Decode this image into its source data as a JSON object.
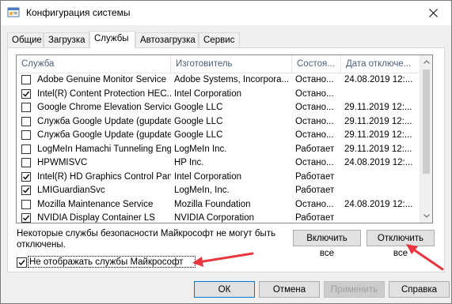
{
  "window": {
    "title": "Конфигурация системы"
  },
  "tabs": [
    {
      "label": "Общие"
    },
    {
      "label": "Загрузка"
    },
    {
      "label": "Службы"
    },
    {
      "label": "Автозагрузка"
    },
    {
      "label": "Сервис"
    }
  ],
  "columns": {
    "service": "Служба",
    "manufacturer": "Изготовитель",
    "status": "Состоя...",
    "date": "Дата отключе..."
  },
  "services": [
    {
      "name": "Adobe Genuine Monitor Service",
      "manufacturer": "Adobe Systems, Incorpora...",
      "status": "Остано...",
      "date": "24.08.2019 12:...",
      "checked": false
    },
    {
      "name": "Intel(R) Content Protection HEC...",
      "manufacturer": "Intel Corporation",
      "status": "Остано...",
      "date": "",
      "checked": true
    },
    {
      "name": "Google Chrome Elevation Service",
      "manufacturer": "Google LLC",
      "status": "Остано...",
      "date": "29.11.2019 12:...",
      "checked": false
    },
    {
      "name": "Служба Google Update (gupdate)",
      "manufacturer": "Google LLC",
      "status": "Остано...",
      "date": "29.11.2019 12:...",
      "checked": false
    },
    {
      "name": "Служба Google Update (gupdatem)",
      "manufacturer": "Google LLC",
      "status": "Остано...",
      "date": "29.11.2019 12:...",
      "checked": false
    },
    {
      "name": "LogMeIn Hamachi Tunneling Engine",
      "manufacturer": "LogMeIn Inc.",
      "status": "Работает",
      "date": "29.11.2019 12:...",
      "checked": false
    },
    {
      "name": "HPWMISVC",
      "manufacturer": "HP Inc.",
      "status": "Остано...",
      "date": "24.08.2019 12:...",
      "checked": false
    },
    {
      "name": "Intel(R) HD Graphics Control Pan...",
      "manufacturer": "Intel Corporation",
      "status": "Работает",
      "date": "",
      "checked": true
    },
    {
      "name": "LMIGuardianSvc",
      "manufacturer": "LogMeIn, Inc.",
      "status": "Работает",
      "date": "",
      "checked": true
    },
    {
      "name": "Mozilla Maintenance Service",
      "manufacturer": "Mozilla Foundation",
      "status": "Остано...",
      "date": "24.08.2019 12:...",
      "checked": false
    },
    {
      "name": "NVIDIA Display Container LS",
      "manufacturer": "NVIDIA Corporation",
      "status": "Работает",
      "date": "",
      "checked": true
    }
  ],
  "note": "Некоторые службы безопасности Майкрософт не могут быть отключены.",
  "buttons": {
    "enable_all": "Включить все",
    "disable_all": "Отключить все",
    "ok": "ОК",
    "cancel": "Отмена",
    "apply": "Применить",
    "help": "Справка"
  },
  "hide_ms": {
    "label": "Не отображать службы Майкрософт",
    "checked": true
  },
  "colors": {
    "arrow": "#e8363c",
    "focus": "#0078d7"
  }
}
